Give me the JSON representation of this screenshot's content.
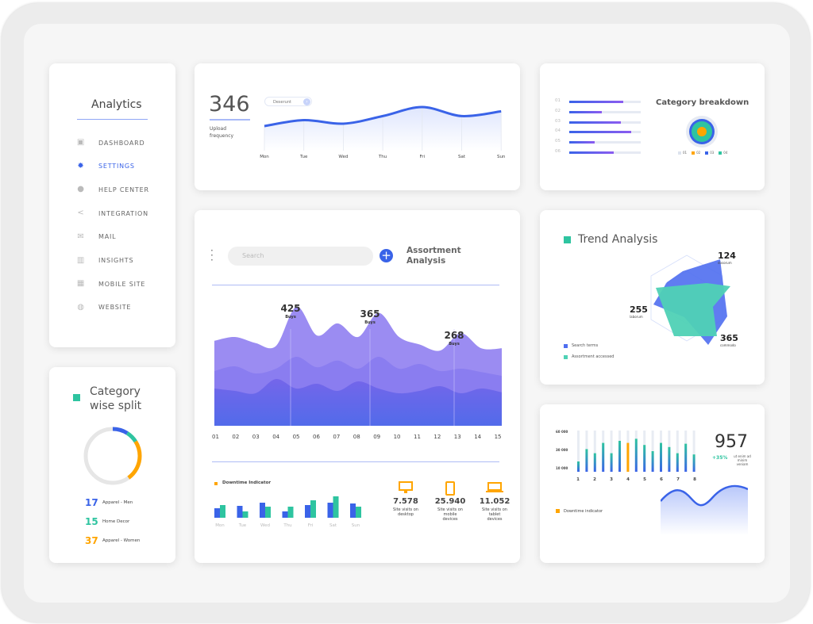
{
  "sidebar": {
    "title": "Analytics",
    "items": [
      {
        "label": "DASHBOARD",
        "icon": "briefcase-icon",
        "glyph": "▣"
      },
      {
        "label": "SETTINGS",
        "icon": "gear-icon",
        "glyph": "✹",
        "active": true
      },
      {
        "label": "HELP CENTER",
        "icon": "help-icon",
        "glyph": "●"
      },
      {
        "label": "INTEGRATION",
        "icon": "share-icon",
        "glyph": "<"
      },
      {
        "label": "MAIL",
        "icon": "mail-icon",
        "glyph": "✉"
      },
      {
        "label": "INSIGHTS",
        "icon": "bar-chart-icon",
        "glyph": "▥"
      },
      {
        "label": "MOBILE SITE",
        "icon": "calculator-icon",
        "glyph": "▦"
      },
      {
        "label": "WEBSITE",
        "icon": "globe-icon",
        "glyph": "◍"
      }
    ]
  },
  "category_split": {
    "title_line1": "Category",
    "title_line2": "wise split",
    "items": [
      {
        "value": "17",
        "label": "Apparel - Men",
        "color": "#3a63e8"
      },
      {
        "value": "15",
        "label": "Home Decor",
        "color": "#2ec4a0"
      },
      {
        "value": "37",
        "label": "Apparel - Women",
        "color": "#ffa500"
      }
    ]
  },
  "upload": {
    "value": "346",
    "label_line1": "Upload",
    "label_line2": "frequency",
    "pill": "Deserunt",
    "days": [
      "Mon",
      "Tue",
      "Wed",
      "Thu",
      "Fri",
      "Sat",
      "Sun"
    ],
    "values": [
      20,
      45,
      30,
      62,
      100,
      62,
      82
    ]
  },
  "assortment": {
    "search_placeholder": "Search",
    "title_line1": "Assortment",
    "title_line2": "Analysis",
    "peaks": [
      {
        "value": "425",
        "label": "Buys"
      },
      {
        "value": "365",
        "label": "Buys"
      },
      {
        "value": "268",
        "label": "Buys"
      }
    ],
    "x_labels": [
      "01",
      "02",
      "03",
      "04",
      "05",
      "06",
      "07",
      "08",
      "09",
      "10",
      "11",
      "12",
      "13",
      "14",
      "15"
    ],
    "series": [
      [
        55,
        60,
        52,
        48,
        100,
        62,
        78,
        60,
        92,
        60,
        50,
        42,
        65,
        45,
        45
      ],
      [
        40,
        50,
        35,
        45,
        70,
        48,
        62,
        45,
        70,
        45,
        55,
        40,
        45,
        38,
        30
      ],
      [
        20,
        15,
        10,
        40,
        20,
        30,
        15,
        35,
        20,
        10,
        15,
        25,
        10,
        20,
        12
      ]
    ],
    "downtime_label": "Downtime Indicator",
    "weekly_days": [
      "Mon",
      "Tue",
      "Wed",
      "Thu",
      "Fri",
      "Sat",
      "Sun"
    ],
    "weekly_blue": [
      12,
      15,
      19,
      8,
      16,
      19,
      18
    ],
    "weekly_green": [
      16,
      8,
      14,
      14,
      22,
      27,
      14
    ],
    "stats": [
      {
        "icon": "desktop-icon",
        "value": "7.578",
        "label": "Site visits on desktop"
      },
      {
        "icon": "mobile-icon",
        "value": "25.940",
        "label": "Site visits on mobile devices"
      },
      {
        "icon": "laptop-icon",
        "value": "11.052",
        "label": "Site visits on tablet devices"
      }
    ]
  },
  "breakdown": {
    "title": "Category breakdown",
    "rows": [
      {
        "label": "01",
        "value": 75
      },
      {
        "label": "02",
        "value": 46
      },
      {
        "label": "03",
        "value": 72
      },
      {
        "label": "04",
        "value": 87
      },
      {
        "label": "05",
        "value": 36
      },
      {
        "label": "06",
        "value": 62
      }
    ],
    "legend": [
      {
        "label": "01",
        "color": "#dde3ee"
      },
      {
        "label": "02",
        "color": "#ffa500"
      },
      {
        "label": "03",
        "color": "#3a63e8"
      },
      {
        "label": "04",
        "color": "#2ec4a0"
      }
    ]
  },
  "trend": {
    "title": "Trend Analysis",
    "labels": [
      {
        "value": "124",
        "label": "dosorum"
      },
      {
        "value": "255",
        "label": "laborum"
      },
      {
        "value": "365",
        "label": "commodo"
      }
    ],
    "legend": [
      {
        "label": "Search terms",
        "color": "#4f6ef0"
      },
      {
        "label": "Assortment accessed",
        "color": "#4fd1b5"
      }
    ]
  },
  "bars": {
    "y_labels": [
      "60 000",
      "30 000",
      "10 000"
    ],
    "x_labels": [
      "1",
      "2",
      "3",
      "4",
      "5",
      "6",
      "7",
      "8"
    ],
    "values": [
      25,
      55,
      45,
      70,
      45,
      75,
      70,
      80,
      65,
      50,
      70,
      60,
      45,
      68,
      42
    ],
    "highlight_index": 6,
    "big_value": "957",
    "change": "+35%",
    "caption": "ut enim ad minim veniam",
    "downtime_label": "Downtime indicator"
  },
  "colors": {
    "blue": "#3a63e8",
    "green": "#2ec4a0",
    "orange": "#ffa500",
    "purple": "#8b7cf0"
  }
}
